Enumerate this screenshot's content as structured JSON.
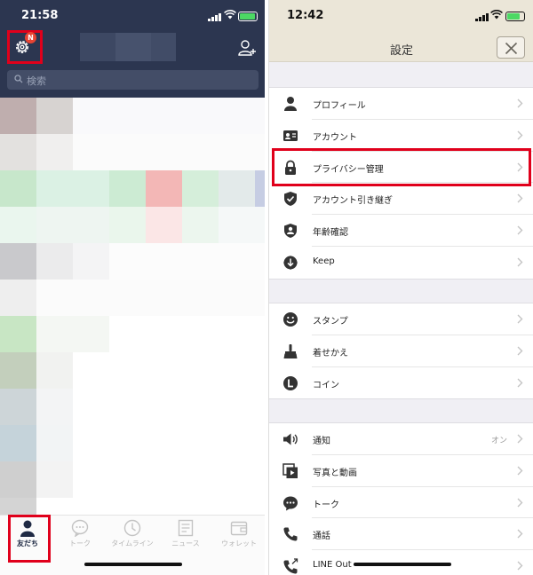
{
  "left": {
    "status": {
      "time": "21:58"
    },
    "header": {
      "settings_badge": "N"
    },
    "search": {
      "placeholder": "検索"
    },
    "tabs": [
      {
        "label": "友だち",
        "icon": "person-icon",
        "active": true
      },
      {
        "label": "トーク",
        "icon": "chat-bubble-icon",
        "active": false
      },
      {
        "label": "タイムライン",
        "icon": "clock-icon",
        "active": false
      },
      {
        "label": "ニュース",
        "icon": "news-icon",
        "active": false
      },
      {
        "label": "ウォレット",
        "icon": "wallet-icon",
        "active": false
      }
    ],
    "colors": {
      "header_bg": "#2c3650",
      "highlight": "#e0001b",
      "battery": "#4cd964"
    }
  },
  "right": {
    "status": {
      "time": "12:42"
    },
    "header": {
      "title": "設定"
    },
    "sections": [
      {
        "items": [
          {
            "label": "プロフィール",
            "icon": "person-icon",
            "value": ""
          },
          {
            "label": "アカウント",
            "icon": "id-card-icon",
            "value": ""
          },
          {
            "label": "プライバシー管理",
            "icon": "lock-icon",
            "value": ""
          },
          {
            "label": "アカウント引き継ぎ",
            "icon": "shield-check-icon",
            "value": ""
          },
          {
            "label": "年齢確認",
            "icon": "badge-user-icon",
            "value": ""
          },
          {
            "label": "Keep",
            "icon": "keep-icon",
            "value": ""
          }
        ]
      },
      {
        "items": [
          {
            "label": "スタンプ",
            "icon": "smiley-icon",
            "value": ""
          },
          {
            "label": "着せかえ",
            "icon": "brush-icon",
            "value": ""
          },
          {
            "label": "コイン",
            "icon": "coin-icon",
            "value": ""
          }
        ]
      },
      {
        "items": [
          {
            "label": "通知",
            "icon": "speaker-icon",
            "value": "オン"
          },
          {
            "label": "写真と動画",
            "icon": "photo-video-icon",
            "value": ""
          },
          {
            "label": "トーク",
            "icon": "chat-bubble-icon",
            "value": ""
          },
          {
            "label": "通話",
            "icon": "phone-icon",
            "value": ""
          },
          {
            "label": "LINE Out",
            "icon": "phone-out-icon",
            "value": ""
          }
        ]
      }
    ],
    "colors": {
      "header_bg": "#ebe6d8",
      "highlight": "#e0001b"
    }
  }
}
